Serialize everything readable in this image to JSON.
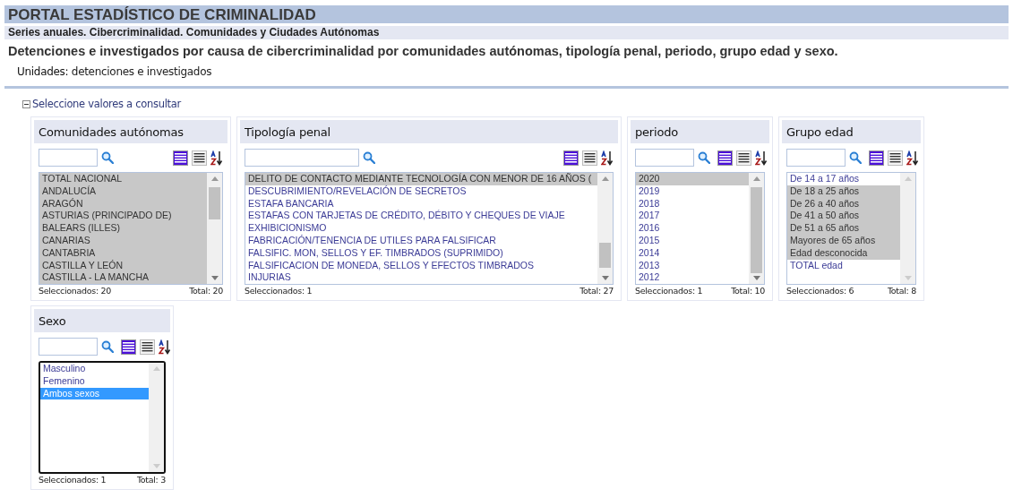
{
  "portal_title": "PORTAL ESTADÍSTICO DE CRIMINALIDAD",
  "series_title": "Series anuales. Cibercriminalidad. Comunidades y Ciudades Autónomas",
  "table_title": "Detenciones e investigados por causa de cibercriminalidad por comunidades autónomas, tipología penal, periodo, grupo edad y sexo.",
  "units": {
    "label": "Unidades:",
    "value": "detenciones e investigados"
  },
  "selection_section": {
    "label": "Seleccione valores a consultar",
    "expanded": true
  },
  "variables": [
    {
      "title": "Comunidades autónomas",
      "focused": false,
      "items": [
        {
          "label": "TOTAL NACIONAL",
          "selected": true
        },
        {
          "label": "ANDALUCÍA",
          "selected": true
        },
        {
          "label": "ARAGÓN",
          "selected": true
        },
        {
          "label": "ASTURIAS (PRINCIPADO DE)",
          "selected": true
        },
        {
          "label": "BALEARS (ILLES)",
          "selected": true
        },
        {
          "label": "CANARIAS",
          "selected": true
        },
        {
          "label": "CANTABRIA",
          "selected": true
        },
        {
          "label": "CASTILLA Y LEÓN",
          "selected": true
        },
        {
          "label": "CASTILLA - LA MANCHA",
          "selected": true
        }
      ],
      "selected_count": "Seleccionados: 20",
      "total": "Total: 20"
    },
    {
      "title": "Tipología penal",
      "focused": false,
      "items": [
        {
          "label": "DELITO DE CONTACTO MEDIANTE TECNOLOGÍA CON MENOR DE 16 AÑOS (",
          "selected": true
        },
        {
          "label": "DESCUBRIMIENTO/REVELACIÓN DE SECRETOS",
          "selected": false
        },
        {
          "label": "ESTAFA BANCARIA",
          "selected": false
        },
        {
          "label": "ESTAFAS CON TARJETAS DE CRÉDITO, DÉBITO Y CHEQUES DE VIAJE",
          "selected": false
        },
        {
          "label": "EXHIBICIONISMO",
          "selected": false
        },
        {
          "label": "FABRICACIÓN/TENENCIA DE UTILES PARA FALSIFICAR",
          "selected": false
        },
        {
          "label": "FALSIFIC. MON, SELLOS Y EF. TIMBRADOS (SUPRIMIDO)",
          "selected": false
        },
        {
          "label": "FALSIFICACION DE MONEDA, SELLOS Y EFECTOS TIMBRADOS",
          "selected": false
        },
        {
          "label": "INJURIAS",
          "selected": false
        }
      ],
      "selected_count": "Seleccionados: 1",
      "total": "Total: 27"
    },
    {
      "title": "periodo",
      "focused": false,
      "items": [
        {
          "label": "2020",
          "selected": true
        },
        {
          "label": "2019",
          "selected": false
        },
        {
          "label": "2018",
          "selected": false
        },
        {
          "label": "2017",
          "selected": false
        },
        {
          "label": "2016",
          "selected": false
        },
        {
          "label": "2015",
          "selected": false
        },
        {
          "label": "2014",
          "selected": false
        },
        {
          "label": "2013",
          "selected": false
        },
        {
          "label": "2012",
          "selected": false
        }
      ],
      "selected_count": "Seleccionados: 1",
      "total": "Total: 10"
    },
    {
      "title": "Grupo edad",
      "focused": false,
      "items": [
        {
          "label": "De 14 a 17 años",
          "selected": false
        },
        {
          "label": "De 18 a 25 años",
          "selected": true
        },
        {
          "label": "De 26 a 40 años",
          "selected": true
        },
        {
          "label": "De 41 a 50 años",
          "selected": true
        },
        {
          "label": "De 51 a 65 años",
          "selected": true
        },
        {
          "label": "Mayores de 65 años",
          "selected": true
        },
        {
          "label": "Edad desconocida",
          "selected": true
        },
        {
          "label": "TOTAL edad",
          "selected": false
        }
      ],
      "selected_count": "Seleccionados: 6",
      "total": "Total: 8"
    },
    {
      "title": "Sexo",
      "focused": true,
      "items": [
        {
          "label": "Masculino",
          "selected": false
        },
        {
          "label": "Femenino",
          "selected": false
        },
        {
          "label": "Ambos sexos",
          "selected": true
        }
      ],
      "selected_count": "Seleccionados: 1",
      "total": "Total: 3"
    }
  ]
}
